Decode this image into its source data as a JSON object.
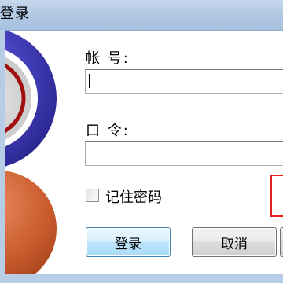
{
  "window": {
    "title": "登录"
  },
  "form": {
    "account_label": "帐 号:",
    "account_value": "",
    "password_label": "口 令:",
    "password_value": "",
    "remember_label": "记住密码",
    "remember_checked": false
  },
  "buttons": {
    "login_label": "登录",
    "cancel_label": "取消"
  },
  "colors": {
    "titlebar": "#b2c9e4",
    "logo_blue": "#3e3bb0",
    "logo_orange": "#c85a2c",
    "highlight_box": "#e02020",
    "ok_button_border": "#3c7fb1"
  },
  "icons": {
    "logo": "app-logo-icon"
  }
}
